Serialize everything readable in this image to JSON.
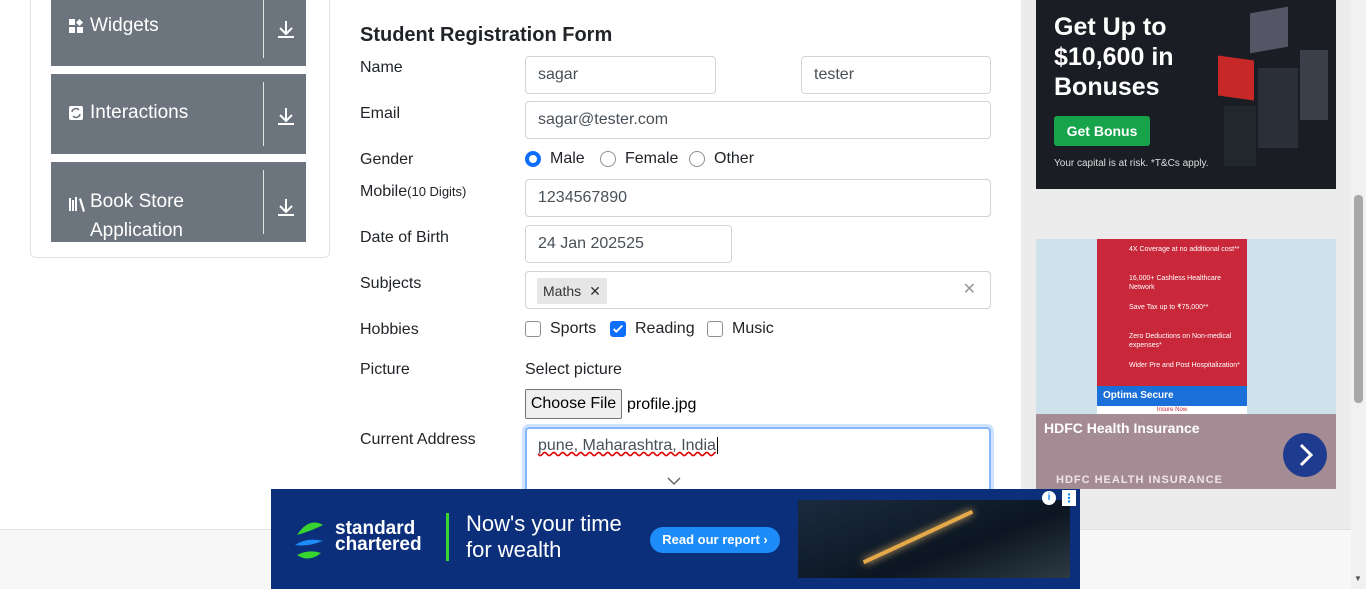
{
  "sidebar": {
    "groups": [
      {
        "label": "Widgets",
        "icon": "widgets-icon"
      },
      {
        "label": "Interactions",
        "icon": "interactions-icon"
      },
      {
        "label": "Book Store",
        "label2": "Application",
        "icon": "book-store-icon"
      }
    ]
  },
  "form": {
    "title": "Student Registration Form",
    "name_label": "Name",
    "first_name": "sagar",
    "last_name": "tester",
    "email_label": "Email",
    "email": "sagar@tester.com",
    "gender_label": "Gender",
    "genders": [
      "Male",
      "Female",
      "Other"
    ],
    "gender_selected": "Male",
    "mobile_label": "Mobile",
    "mobile_hint": "(10 Digits)",
    "mobile": "1234567890",
    "dob_label": "Date of Birth",
    "dob": "24 Jan 202525",
    "subjects_label": "Subjects",
    "subject_tag": "Maths",
    "hobbies_label": "Hobbies",
    "hobbies": [
      {
        "label": "Sports",
        "checked": false
      },
      {
        "label": "Reading",
        "checked": true
      },
      {
        "label": "Music",
        "checked": false
      }
    ],
    "picture_label": "Picture",
    "select_picture": "Select picture",
    "choose_file": "Choose File",
    "file_name": "profile.jpg",
    "address_label": "Current Address",
    "address": "pune, Maharashtra, India"
  },
  "ads": {
    "top_right": {
      "headline_1": "Get Up to",
      "headline_2": "$10,600 in",
      "headline_3": "Bonuses",
      "button": "Get Bonus",
      "disclaimer": "Your capital is at risk. *T&Cs apply."
    },
    "mid_right": {
      "features": [
        "4X Coverage at no additional cost**",
        "16,000+ Cashless Healthcare Network",
        "Save Tax up to ₹75,000**",
        "Zero Deductions on Non-medical expenses*",
        "Wider Pre and Post Hospitalization*"
      ],
      "brand": "Optima Secure",
      "insure": "Insure Now",
      "title": "HDFC Health Insurance",
      "subtitle": "HDFC HEALTH INSURANCE"
    },
    "bottom": {
      "brand_1": "standard",
      "brand_2": "chartered",
      "tagline_1": "Now's your time",
      "tagline_2": "for wealth",
      "cta": "Read our report ›"
    }
  },
  "colors": {
    "sidebar_group": "#6c757d",
    "accent": "#0d6efd",
    "ad_green": "#16a34a",
    "sc_blue": "#0b2f7b"
  }
}
